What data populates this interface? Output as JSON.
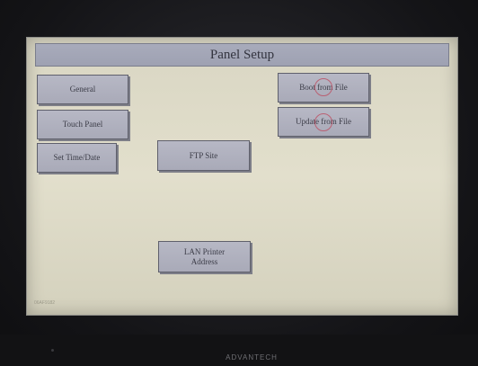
{
  "window": {
    "title": "Panel Setup"
  },
  "buttons": {
    "general": "General",
    "touch_panel": "Touch Panel",
    "set_time_date": "Set Time/Date",
    "ftp_site": "FTP Site",
    "lan_printer_line1": "LAN Printer",
    "lan_printer_line2": "Address",
    "boot_from_file": "Boot from File",
    "update_from_file": "Update from File"
  },
  "footer": {
    "version": "06AF9182"
  },
  "device": {
    "brand": "ADVANTECH"
  },
  "colors": {
    "screen_bg": "#dedbc8",
    "title_bar": "#a3a6b7",
    "button_face": "#b0b1bf",
    "touch_mark": "#be465a"
  }
}
